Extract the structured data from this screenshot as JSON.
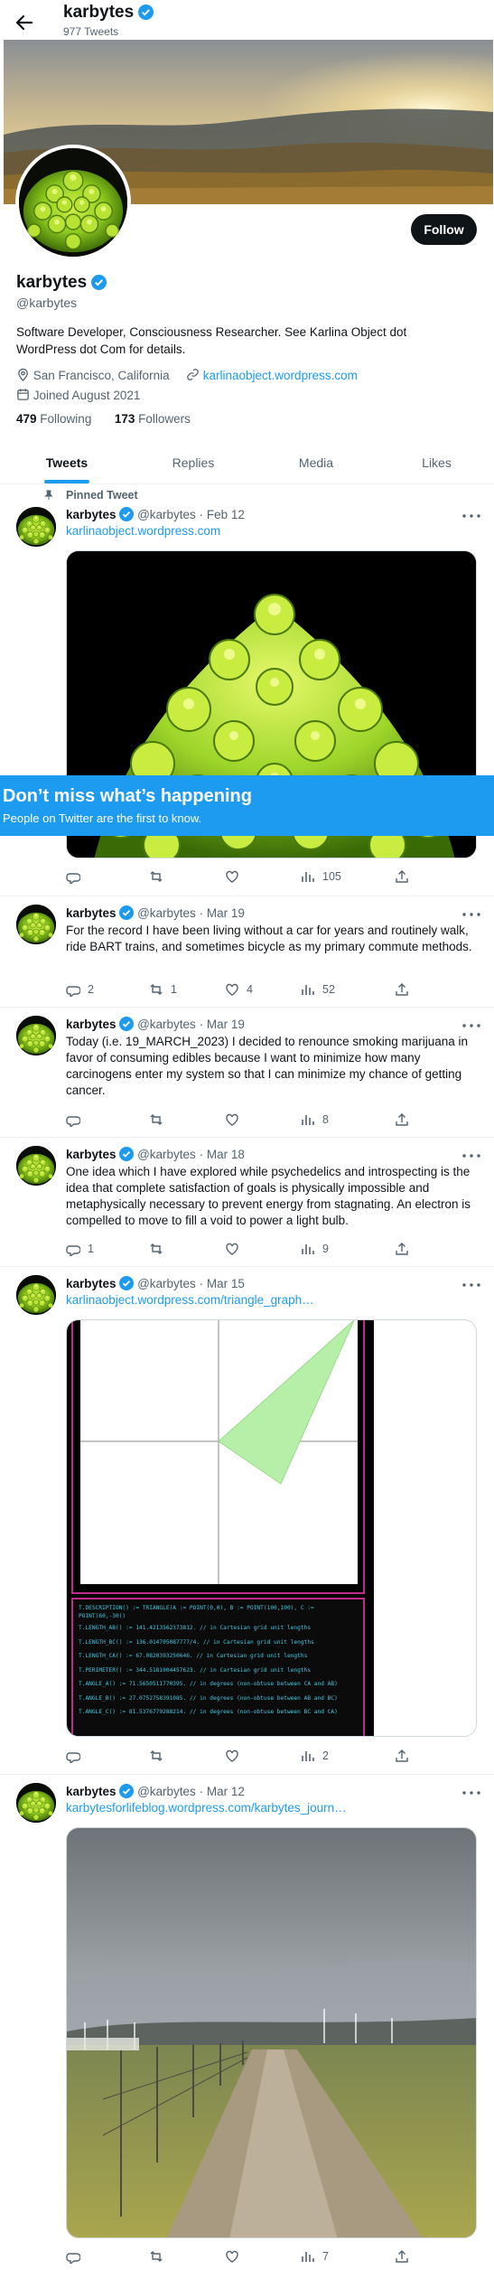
{
  "header": {
    "name": "karbytes",
    "tweet_count": "977 Tweets"
  },
  "profile": {
    "name": "karbytes",
    "handle": "@karbytes",
    "bio": "Software Developer, Consciousness Researcher. See Karlina Object dot WordPress dot Com for details.",
    "location": "San Francisco, California",
    "website": "karlinaobject.wordpress.com",
    "joined": "Joined August 2021",
    "following_count": "479",
    "following_label": "Following",
    "followers_count": "173",
    "followers_label": "Followers",
    "follow_label": "Follow"
  },
  "tabs": [
    {
      "label": "Tweets",
      "active": true
    },
    {
      "label": "Replies",
      "active": false
    },
    {
      "label": "Media",
      "active": false
    },
    {
      "label": "Likes",
      "active": false
    }
  ],
  "pinned_label": "Pinned Tweet",
  "tweets": [
    {
      "name": "karbytes",
      "handle": "@karbytes",
      "date": "Feb 12",
      "text": "",
      "link": "karlinaobject.wordpress.com",
      "replies": "",
      "retweets": "",
      "likes": "",
      "views": "105"
    },
    {
      "name": "karbytes",
      "handle": "@karbytes",
      "date": "Mar 19",
      "text": "For the record I have been living without a car for years and routinely walk, ride BART trains, and sometimes bicycle as my primary commute methods.",
      "link": "",
      "replies": "2",
      "retweets": "1",
      "likes": "4",
      "views": "52"
    },
    {
      "name": "karbytes",
      "handle": "@karbytes",
      "date": "Mar 19",
      "text": "Today (i.e. 19_MARCH_2023) I decided to renounce smoking marijuana in favor of consuming edibles because I want to minimize how many carcinogens enter my system so that I can minimize my chance of getting cancer.",
      "link": "",
      "replies": "",
      "retweets": "",
      "likes": "",
      "views": "8"
    },
    {
      "name": "karbytes",
      "handle": "@karbytes",
      "date": "Mar 18",
      "text": "One idea which I have explored while psychedelics and introspecting is the idea that complete satisfaction of goals is physically impossible and metaphysically necessary to prevent energy from stagnating. An electron is compelled to move to fill a void to power a light bulb.",
      "link": "",
      "replies": "1",
      "retweets": "",
      "likes": "",
      "views": "9"
    },
    {
      "name": "karbytes",
      "handle": "@karbytes",
      "date": "Mar 15",
      "text": "",
      "link": "karlinaobject.wordpress.com/triangle_graph…",
      "replies": "",
      "retweets": "",
      "likes": "",
      "views": "2"
    },
    {
      "name": "karbytes",
      "handle": "@karbytes",
      "date": "Mar 12",
      "text": "",
      "link": "karbytesforlifeblog.wordpress.com/karbytes_journ…",
      "replies": "",
      "retweets": "",
      "likes": "",
      "views": "7"
    }
  ],
  "code_lines": [
    "T.DESCRIPTION() := TRIANGLE(A := POINT(0,0), B := POINT(100,100), C :=",
    "POINT(60,-30))",
    "T.LENGTH_AB() := 141.4213562373812. // in Cartesian grid unit lengths",
    "T.LENGTH_BC() := 136.014705087777/4. // in Cartesian grid unit lengths",
    "T.LENGTH_CA() := 67.0820393250646. // in Cartesian grid unit lengths",
    "T.PERIMETER() := 344.5181004457623. // in Cartesian grid unit lengths",
    "T.ANGLE_A() := 71.5650511770395. // in degrees (non-obtuse between CA and AB)",
    "T.ANGLE_B() := 27.0752758391085. // in degrees (non-obtuse between AB and BC)",
    "T.ANGLE_C() := 81.5376779288214. // in degrees (non-obtuse between BC and CA)"
  ],
  "signup": {
    "title": "Don’t miss what’s happening",
    "subtitle": "People on Twitter are the first to know."
  },
  "colors": {
    "accent": "#1d9bf0",
    "text": "#0f1419",
    "muted": "#536471",
    "code_bg": "#0b0b0b",
    "code_text": "#40c8e0",
    "frame": "#c02a8c"
  }
}
